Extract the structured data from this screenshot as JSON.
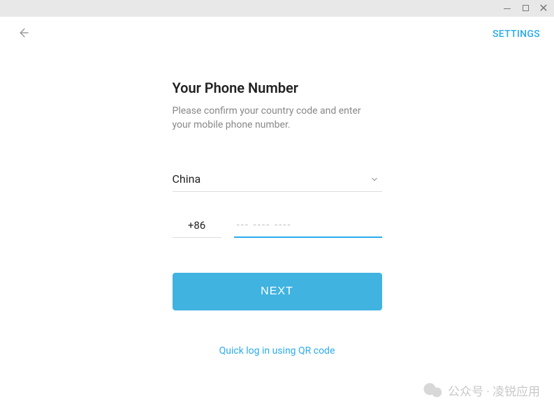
{
  "topbar": {
    "settings_label": "SETTINGS"
  },
  "form": {
    "title": "Your Phone Number",
    "subtitle": "Please confirm your country code and enter your mobile phone number.",
    "country": "China",
    "dial_code": "+86",
    "phone_placeholder": "--- ---- ----",
    "next_label": "NEXT",
    "qr_link_label": "Quick log in using QR code"
  },
  "watermark": {
    "text": "公众号 · 凌锐应用"
  }
}
